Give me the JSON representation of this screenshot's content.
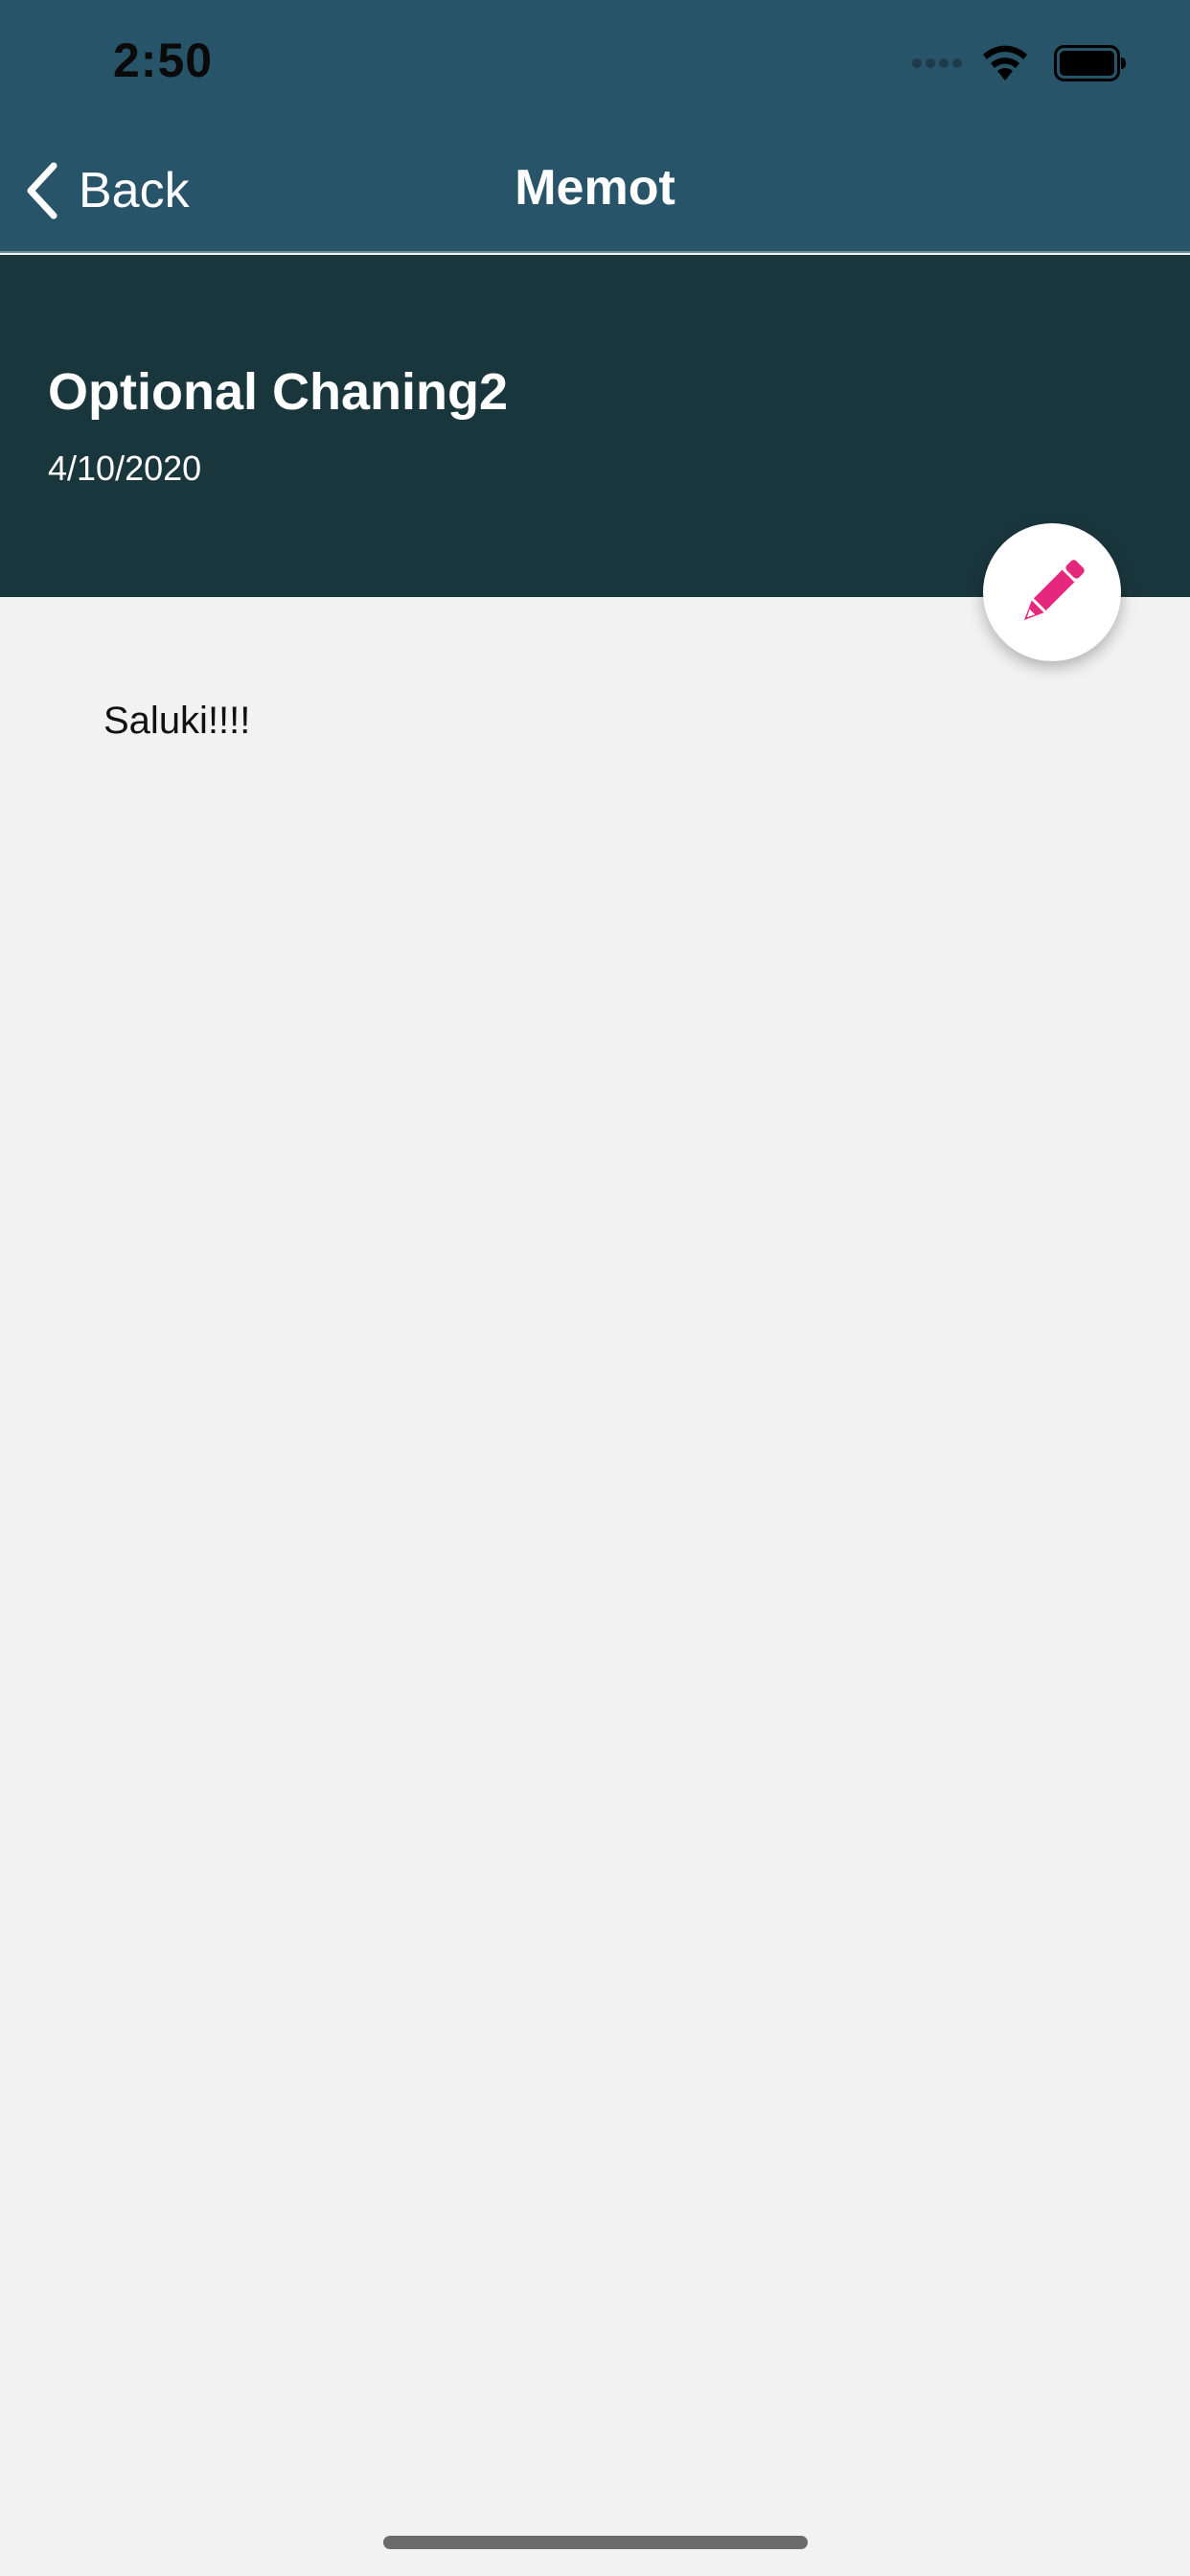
{
  "status_bar": {
    "time": "2:50",
    "icons": [
      "cellular-signal-icon",
      "wifi-icon",
      "battery-icon"
    ]
  },
  "nav_bar": {
    "back_label": "Back",
    "title": "Memot"
  },
  "memo": {
    "title": "Optional Chaning2",
    "date": "4/10/2020",
    "body": "Saluki!!!!"
  },
  "fab": {
    "icon": "pencil-icon"
  },
  "colors": {
    "nav_background": "#285469",
    "header_background": "#1a363d",
    "content_background": "#f2f2f2",
    "accent_pink": "#e6287d",
    "fab_background": "#ffffff"
  }
}
